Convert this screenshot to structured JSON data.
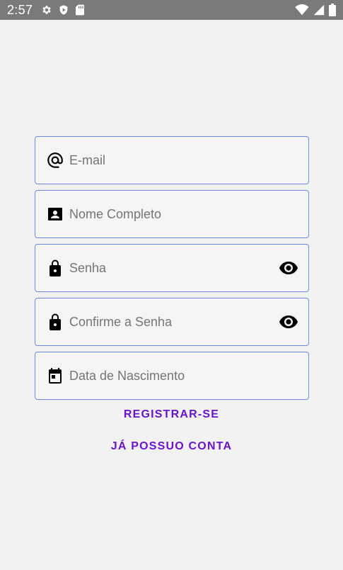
{
  "status_bar": {
    "time": "2:57",
    "icons": [
      "gear-icon",
      "shield-play-icon",
      "sd-card-icon",
      "wifi-icon",
      "signal-icon",
      "battery-icon"
    ]
  },
  "form": {
    "email": {
      "placeholder": "E-mail",
      "value": "",
      "icon": "at-icon"
    },
    "full_name": {
      "placeholder": "Nome Completo",
      "value": "",
      "icon": "contact-card-icon"
    },
    "password": {
      "placeholder": "Senha",
      "value": "",
      "icon": "lock-icon",
      "trailing_icon": "eye-icon"
    },
    "confirm_password": {
      "placeholder": "Confirme a Senha",
      "value": "",
      "icon": "lock-icon",
      "trailing_icon": "eye-icon"
    },
    "birth_date": {
      "placeholder": "Data de Nascimento",
      "value": "",
      "icon": "calendar-icon"
    }
  },
  "actions": {
    "register_label": "REGISTRAR-SE",
    "login_label": "JÁ POSSUO CONTA"
  },
  "colors": {
    "background": "#f2f2f2",
    "status_bar": "#7a7a7a",
    "field_border": "#6f8fe0",
    "accent": "#6a11d6"
  }
}
